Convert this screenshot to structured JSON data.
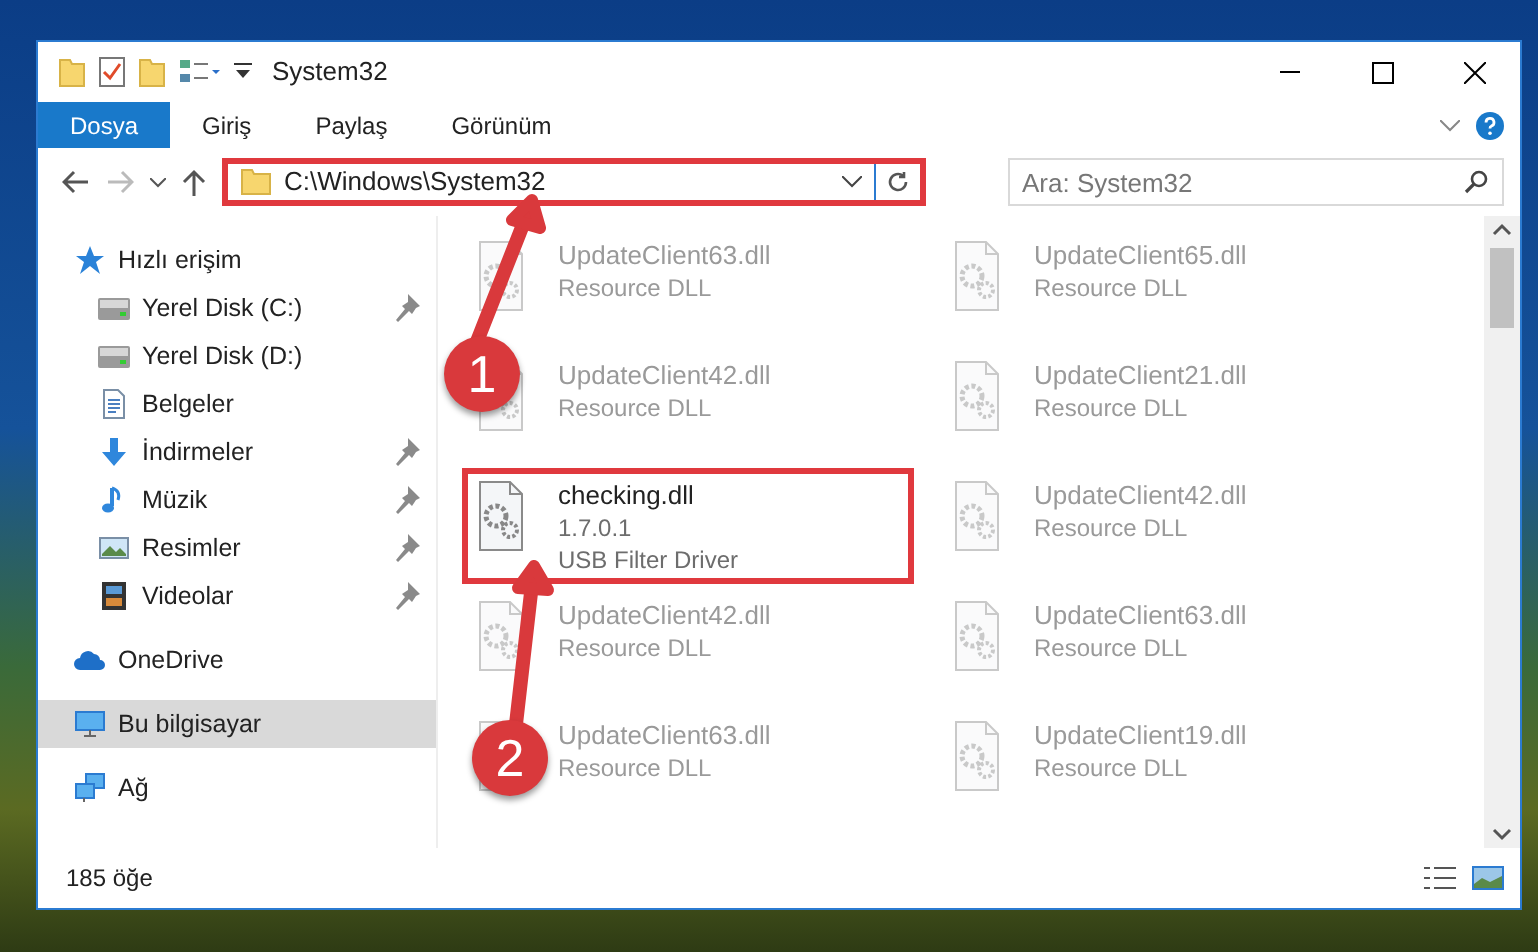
{
  "window": {
    "title": "System32"
  },
  "ribbon_tabs": [
    {
      "label": "Dosya",
      "selected": true
    },
    {
      "label": "Giriş",
      "selected": false
    },
    {
      "label": "Paylaş",
      "selected": false
    },
    {
      "label": "Görünüm",
      "selected": false
    }
  ],
  "address_bar": {
    "path": "C:\\Windows\\System32",
    "highlighted": true
  },
  "search": {
    "placeholder": "Ara: System32"
  },
  "sidebar": {
    "items": [
      {
        "label": "Hızlı erişim",
        "kind": "star",
        "selected": false,
        "children": [
          {
            "label": "Yerel Disk (C:)",
            "kind": "drive",
            "pinned": true,
            "selected": false
          },
          {
            "label": "Yerel Disk (D:)",
            "kind": "drive",
            "pinned": false,
            "selected": false
          },
          {
            "label": "Belgeler",
            "kind": "document",
            "pinned": false,
            "selected": false
          },
          {
            "label": "İndirmeler",
            "kind": "download",
            "pinned": true,
            "selected": false
          },
          {
            "label": "Müzik",
            "kind": "music",
            "pinned": true,
            "selected": false
          },
          {
            "label": "Resimler",
            "kind": "picture",
            "pinned": true,
            "selected": false
          },
          {
            "label": "Videolar",
            "kind": "video",
            "pinned": true,
            "selected": false
          }
        ]
      },
      {
        "label": "OneDrive",
        "kind": "cloud",
        "selected": false
      },
      {
        "label": "Bu bilgisayar",
        "kind": "computer",
        "selected": true
      },
      {
        "label": "Ağ",
        "kind": "network",
        "selected": false
      }
    ]
  },
  "files": [
    {
      "name": "UpdateClient63.dll",
      "details": [
        "Resource DLL"
      ],
      "blurred": true,
      "highlighted": false
    },
    {
      "name": "UpdateClient65.dll",
      "details": [
        "Resource DLL"
      ],
      "blurred": true,
      "highlighted": false
    },
    {
      "name": "UpdateClient42.dll",
      "details": [
        "Resource DLL"
      ],
      "blurred": true,
      "highlighted": false
    },
    {
      "name": "UpdateClient21.dll",
      "details": [
        "Resource DLL"
      ],
      "blurred": true,
      "highlighted": false
    },
    {
      "name": "checking.dll",
      "details": [
        "1.7.0.1",
        "USB Filter Driver"
      ],
      "blurred": false,
      "highlighted": true
    },
    {
      "name": "UpdateClient42.dll",
      "details": [
        "Resource DLL"
      ],
      "blurred": true,
      "highlighted": false
    },
    {
      "name": "UpdateClient42.dll",
      "details": [
        "Resource DLL"
      ],
      "blurred": true,
      "highlighted": false
    },
    {
      "name": "UpdateClient63.dll",
      "details": [
        "Resource DLL"
      ],
      "blurred": true,
      "highlighted": false
    },
    {
      "name": "UpdateClient63.dll",
      "details": [
        "Resource DLL"
      ],
      "blurred": true,
      "highlighted": false
    },
    {
      "name": "UpdateClient19.dll",
      "details": [
        "Resource DLL"
      ],
      "blurred": true,
      "highlighted": false
    }
  ],
  "status_bar": {
    "item_count": "185 öğe"
  },
  "annotations": [
    {
      "number": "1"
    },
    {
      "number": "2"
    }
  ]
}
